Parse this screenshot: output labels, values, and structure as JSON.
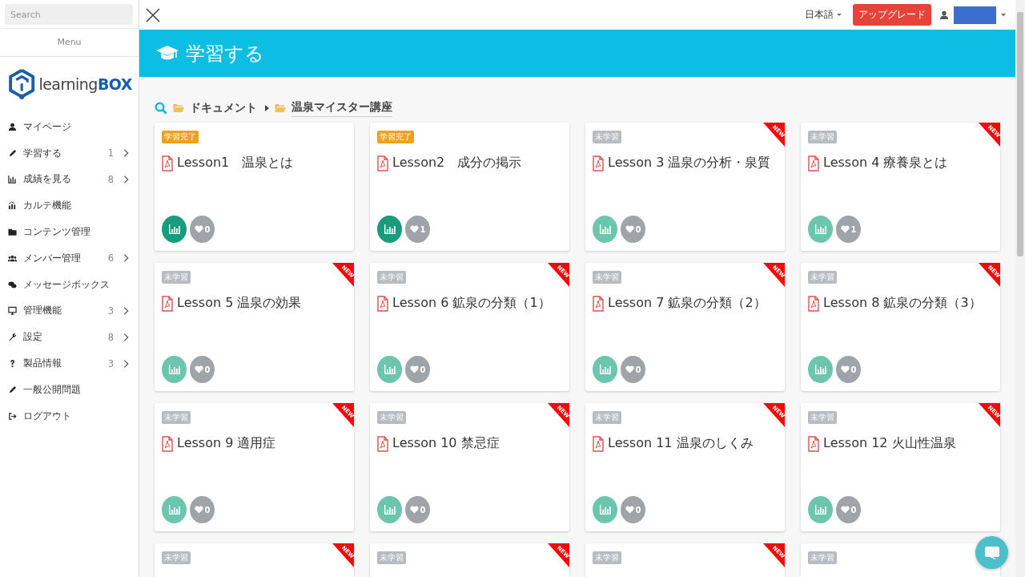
{
  "sidebar": {
    "search": {
      "placeholder": "Search"
    },
    "menu_label": "Menu",
    "logo": {
      "word": "learning",
      "accent": "BOX"
    },
    "items": [
      {
        "kind": "user",
        "label": "マイページ",
        "expandable": false
      },
      {
        "kind": "pencil",
        "label": "学習する",
        "count": "1",
        "expandable": true
      },
      {
        "kind": "chart",
        "label": "成績を見る",
        "count": "8",
        "expandable": true
      },
      {
        "kind": "bars",
        "label": "カルテ機能",
        "expandable": false
      },
      {
        "kind": "folder",
        "label": "コンテンツ管理",
        "expandable": false
      },
      {
        "kind": "users",
        "label": "メンバー管理",
        "count": "6",
        "expandable": true
      },
      {
        "kind": "chat",
        "label": "メッセージボックス",
        "expandable": false
      },
      {
        "kind": "monitor",
        "label": "管理機能",
        "count": "3",
        "expandable": true
      },
      {
        "kind": "wrench",
        "label": "設定",
        "count": "8",
        "expandable": true
      },
      {
        "kind": "question",
        "label": "製品情報",
        "count": "3",
        "expandable": true
      },
      {
        "kind": "pencil",
        "label": "一般公開問題",
        "expandable": false
      },
      {
        "kind": "logout",
        "label": "ログアウト",
        "expandable": false
      }
    ]
  },
  "topbar": {
    "language": "日本語",
    "upgrade": "アップグレード"
  },
  "header": {
    "title": "学習する"
  },
  "breadcrumb": [
    "ドキュメント",
    "温泉マイスター講座"
  ],
  "cards": [
    {
      "kind": "completed",
      "badge": "学習完了",
      "title": "Lesson1　温泉とは",
      "likes": "0"
    },
    {
      "kind": "completed",
      "badge": "学習完了",
      "title": "Lesson2　成分の掲示",
      "likes": "1"
    },
    {
      "kind": "not_started",
      "badge": "未学習",
      "ribbon": "NEW",
      "title": "Lesson 3 温泉の分析・泉質",
      "likes": "0"
    },
    {
      "kind": "not_started",
      "badge": "未学習",
      "ribbon": "NEW",
      "title": "Lesson 4 療養泉とは",
      "likes": "1"
    },
    {
      "kind": "not_started",
      "badge": "未学習",
      "ribbon": "NEW",
      "title": "Lesson 5 温泉の効果",
      "likes": "0"
    },
    {
      "kind": "not_started",
      "badge": "未学習",
      "ribbon": "NEW",
      "title": "Lesson 6 鉱泉の分類（1）",
      "likes": "0"
    },
    {
      "kind": "not_started",
      "badge": "未学習",
      "ribbon": "NEW",
      "title": "Lesson 7 鉱泉の分類（2）",
      "likes": "0"
    },
    {
      "kind": "not_started",
      "badge": "未学習",
      "ribbon": "NEW",
      "title": "Lesson 8 鉱泉の分類（3）",
      "likes": "0"
    },
    {
      "kind": "not_started",
      "badge": "未学習",
      "ribbon": "NEW",
      "title": "Lesson 9 適用症",
      "likes": "0"
    },
    {
      "kind": "not_started",
      "badge": "未学習",
      "ribbon": "NEW",
      "title": "Lesson 10 禁忌症",
      "likes": "0"
    },
    {
      "kind": "not_started",
      "badge": "未学習",
      "ribbon": "NEW",
      "title": "Lesson 11 温泉のしくみ",
      "likes": "0"
    },
    {
      "kind": "not_started",
      "badge": "未学習",
      "ribbon": "NEW",
      "title": "Lesson 12 火山性温泉",
      "likes": "0"
    },
    {
      "kind": "not_started",
      "badge": "未学習",
      "ribbon": "NEW"
    },
    {
      "kind": "not_started",
      "badge": "未学習",
      "ribbon": "NEW"
    },
    {
      "kind": "not_started",
      "badge": "未学習",
      "ribbon": "NEW"
    },
    {
      "kind": "not_started",
      "badge": "未学習"
    }
  ]
}
